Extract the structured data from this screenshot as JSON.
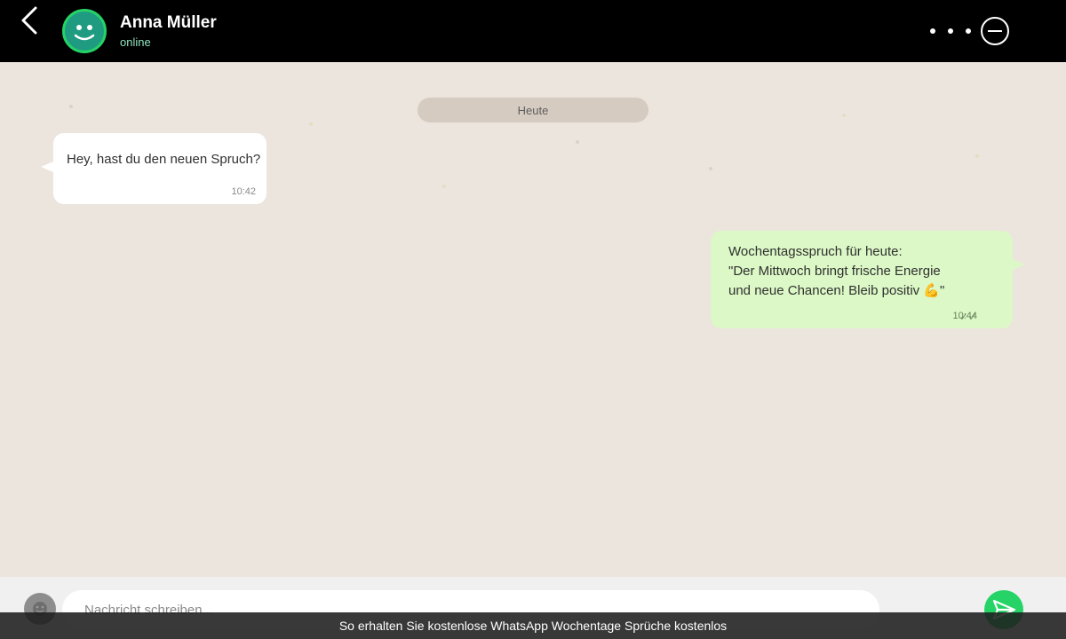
{
  "header": {
    "contact_name": "Anna Müller",
    "contact_status": "online",
    "back_icon": "chevron-left-icon",
    "menu_icon": "more-dots-icon",
    "minus_icon": "minus-circle-icon"
  },
  "chat": {
    "date_separator": "Heute",
    "messages": [
      {
        "direction": "incoming",
        "lines": [
          "Hey, hast du den neuen Spruch?"
        ],
        "time": "10:42"
      },
      {
        "direction": "outgoing",
        "lines": [
          "Wochentagsspruch für heute:",
          "\"Der Mittwoch bringt frische Energie",
          "und neue Chancen! Bleib positiv 💪\""
        ],
        "time": "10:44",
        "ticks": "✓✓"
      }
    ]
  },
  "input": {
    "placeholder": "Nachricht schreiben..."
  },
  "caption": "So erhalten Sie kostenlose WhatsApp Wochentage Sprüche kostenlos",
  "colors": {
    "header_bg": "#000000",
    "chat_bg": "#ece5dd",
    "incoming_bubble": "#ffffff",
    "outgoing_bubble": "#dcf8c6",
    "accent": "#25d366"
  }
}
